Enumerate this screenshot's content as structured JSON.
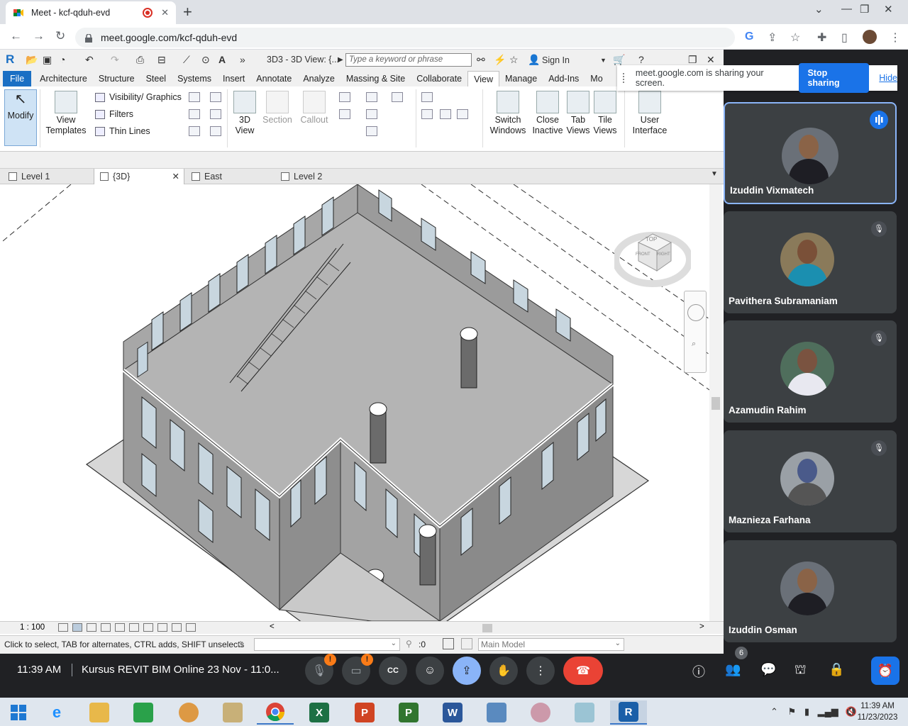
{
  "browser": {
    "tab_title": "Meet - kcf-qduh-evd",
    "url": "meet.google.com/kcf-qduh-evd"
  },
  "revit": {
    "view_title": "3D3 - 3D View: {...",
    "search_placeholder": "Type a keyword or phrase",
    "sign_in": "Sign In",
    "menu": [
      "File",
      "Architecture",
      "Structure",
      "Steel",
      "Systems",
      "Insert",
      "Annotate",
      "Analyze",
      "Massing & Site",
      "Collaborate",
      "View",
      "Manage",
      "Add-Ins",
      "Mo"
    ],
    "active_menu": "View",
    "ribbon": {
      "modify": "Modify",
      "view_templates": [
        "View",
        "Templates"
      ],
      "visibility": "Visibility/ Graphics",
      "filters": "Filters",
      "thin_lines": "Thin  Lines",
      "view3d": [
        "3D",
        "View"
      ],
      "section": "Section",
      "callout": "Callout",
      "switch_windows": [
        "Switch",
        "Windows"
      ],
      "close_inactive": [
        "Close",
        "Inactive"
      ],
      "tab_views": [
        "Tab",
        "Views"
      ],
      "tile_views": [
        "Tile",
        "Views"
      ],
      "user_interface": [
        "User",
        "Interface"
      ]
    },
    "view_tabs": [
      "Level 1",
      "{3D}",
      "East",
      "Level 2"
    ],
    "scale": "1 : 100",
    "status": "Click to select, TAB for alternates, CTRL adds, SHIFT unselects",
    "filter_count": ":0",
    "workset": "Main Model",
    "viewcube": {
      "top": "TOP",
      "front": "FRONT",
      "right": "RIGHT"
    }
  },
  "share_banner": {
    "text": "meet.google.com is sharing your screen.",
    "stop": "Stop sharing",
    "hide": "Hide"
  },
  "participants": [
    {
      "name": "Izuddin Vixmatech",
      "speaking": true
    },
    {
      "name": "Pavithera Subramaniam",
      "muted": true
    },
    {
      "name": "Azamudin Rahim",
      "muted": true
    },
    {
      "name": "Maznieza Farhana",
      "muted": true
    },
    {
      "name": "Izuddin Osman",
      "muted": false
    }
  ],
  "meet_bar": {
    "time": "11:39 AM",
    "meeting_title": "Kursus REVIT BIM Online 23 Nov - 11:0...",
    "people_count": "6",
    "badge": "!"
  },
  "taskbar": {
    "clock_time": "11:39 AM",
    "clock_date": "11/23/2023"
  },
  "colors": {
    "meet_bg": "#202124",
    "tile_bg": "#3c4043",
    "accent": "#1a73e8",
    "end_call": "#ea4335",
    "revit_file_tab": "#1a6fc4"
  }
}
